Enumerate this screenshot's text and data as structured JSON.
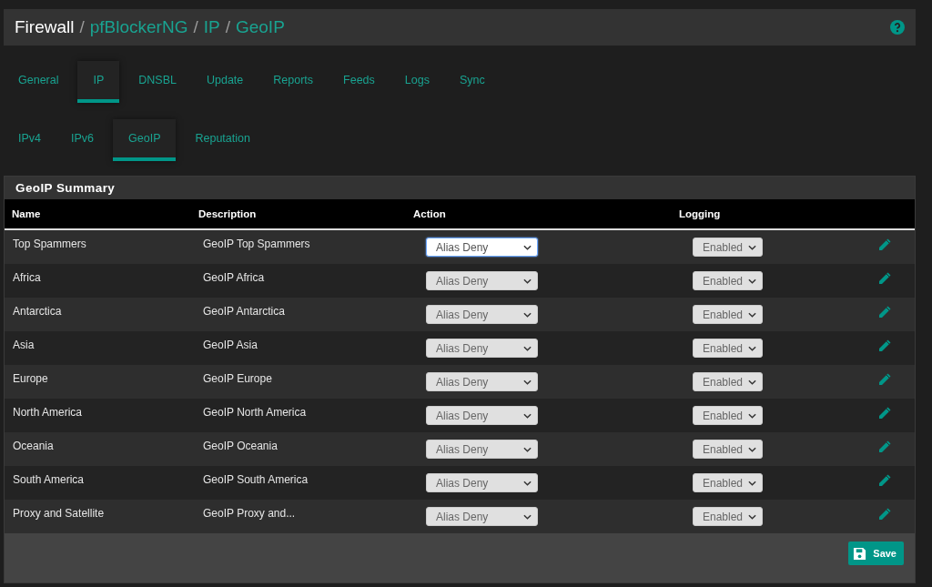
{
  "breadcrumb": [
    {
      "label": "Firewall",
      "link": false
    },
    {
      "separator": "/",
      "label": "pfBlockerNG",
      "link": true
    },
    {
      "separator": "/",
      "label": "IP",
      "link": true
    },
    {
      "separator": "/",
      "label": "GeoIP",
      "link": true
    }
  ],
  "tabs": [
    {
      "label": "General",
      "selected": false
    },
    {
      "label": "IP",
      "selected": true
    },
    {
      "label": "DNSBL",
      "selected": false
    },
    {
      "label": "Update",
      "selected": false
    },
    {
      "label": "Reports",
      "selected": false
    },
    {
      "label": "Feeds",
      "selected": false
    },
    {
      "label": "Logs",
      "selected": false
    },
    {
      "label": "Sync",
      "selected": false
    }
  ],
  "subtabs": [
    {
      "label": "IPv4",
      "selected": false
    },
    {
      "label": "IPv6",
      "selected": false
    },
    {
      "label": "GeoIP",
      "selected": true
    },
    {
      "label": "Reputation",
      "selected": false
    }
  ],
  "panel": {
    "title": "GeoIP Summary",
    "columns": [
      "Name",
      "Description",
      "Action",
      "Logging"
    ],
    "rows": [
      {
        "name": "Top Spammers",
        "description": "GeoIP Top Spammers",
        "action": "Alias Deny",
        "action_focused": true,
        "logging": "Enabled"
      },
      {
        "name": "Africa",
        "description": "GeoIP Africa",
        "action": "Alias Deny",
        "action_focused": false,
        "logging": "Enabled"
      },
      {
        "name": "Antarctica",
        "description": "GeoIP Antarctica",
        "action": "Alias Deny",
        "action_focused": false,
        "logging": "Enabled"
      },
      {
        "name": "Asia",
        "description": "GeoIP Asia",
        "action": "Alias Deny",
        "action_focused": false,
        "logging": "Enabled"
      },
      {
        "name": "Europe",
        "description": "GeoIP Europe",
        "action": "Alias Deny",
        "action_focused": false,
        "logging": "Enabled"
      },
      {
        "name": "North America",
        "description": "GeoIP North America",
        "action": "Alias Deny",
        "action_focused": false,
        "logging": "Enabled"
      },
      {
        "name": "Oceania",
        "description": "GeoIP Oceania",
        "action": "Alias Deny",
        "action_focused": false,
        "logging": "Enabled"
      },
      {
        "name": "South America",
        "description": "GeoIP South America",
        "action": "Alias Deny",
        "action_focused": false,
        "logging": "Enabled"
      },
      {
        "name": "Proxy and Satellite",
        "description": "GeoIP Proxy and...",
        "action": "Alias Deny",
        "action_focused": false,
        "logging": "Enabled"
      }
    ],
    "save_button": "Save"
  }
}
